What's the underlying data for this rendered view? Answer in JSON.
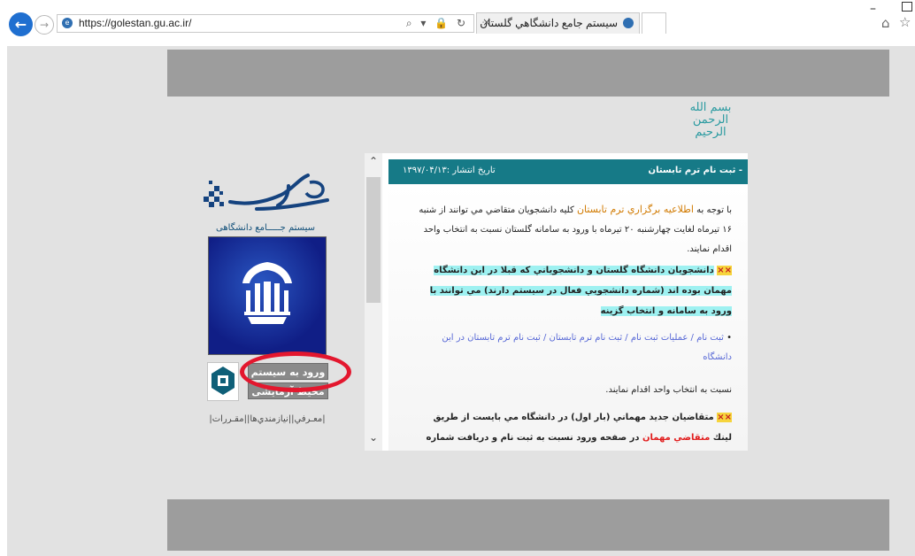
{
  "browser": {
    "url": "https://golestan.gu.ac.ir/",
    "tab_title": "سيستم جامع دانشگاهي گلستان",
    "url_tools": "⌕ ▾ 🔒 ↻",
    "tab_close": "×",
    "home_icon": "home-icon",
    "favorites_icon": "star-icon"
  },
  "page": {
    "bismillah": "بسم الله الرحمن الرحیم",
    "logo": {
      "script": "گلستان",
      "subtitle": "سیستم جـــــامع دانشگاهی"
    },
    "buttons": {
      "login": "ورود به سیستم",
      "test_env": "محیط آزمایشی"
    },
    "bottom_links": "|معـرفي||نيازمندي‌ها||مقـررات|",
    "annotation_color": "#e3172e"
  },
  "news": {
    "title": "- ثبت نام ترم تابستان",
    "date": "تاريخ انتشار :۱۳۹۷/۰۴/۱۳",
    "p1_pre": "با توجه به",
    "p1_link": "اطلاعيه برگزاري ترم تابستان",
    "p1_post": "كليه دانشجويان متقاضي مي توانند از شنبه ۱۶ تيرماه لغايت چهارشنبه ۲۰ تيرماه با ورود به سامانه گلستان نسبت به انتخاب واحد اقدام نمايند.",
    "star": "××",
    "p2": "دانشجويان دانشگاه گلستان و دانشجوياني كه قبلا در اين دانشگاه مهمان بوده اند (شماره دانشجويي فعال در سيستم دارند) مي توانند با ورود به سامانه و انتخاب گزينه",
    "bullet": "ثبت نام / عمليات ثبت نام / ثبت نام ترم تابستان / ثبت نام ترم تابستان در اين دانشگاه",
    "p3": "نسبت به انتخاب واحد اقدام نمايند.",
    "p4_pre": "متقاضيان جديد مهماني (بار اول) در دانشگاه مي بايست از طريق لينك",
    "p4_link": "متقاضي مهمان",
    "p4_post": "در صفحه ورود نسبت به ثبت نام و دريافت شماره دانشجويي"
  },
  "colors": {
    "header_teal": "#167a87",
    "highlight_teal": "#9ef1f1",
    "star_yellow": "#f6d43c",
    "gray_band": "#9d9d9d"
  }
}
